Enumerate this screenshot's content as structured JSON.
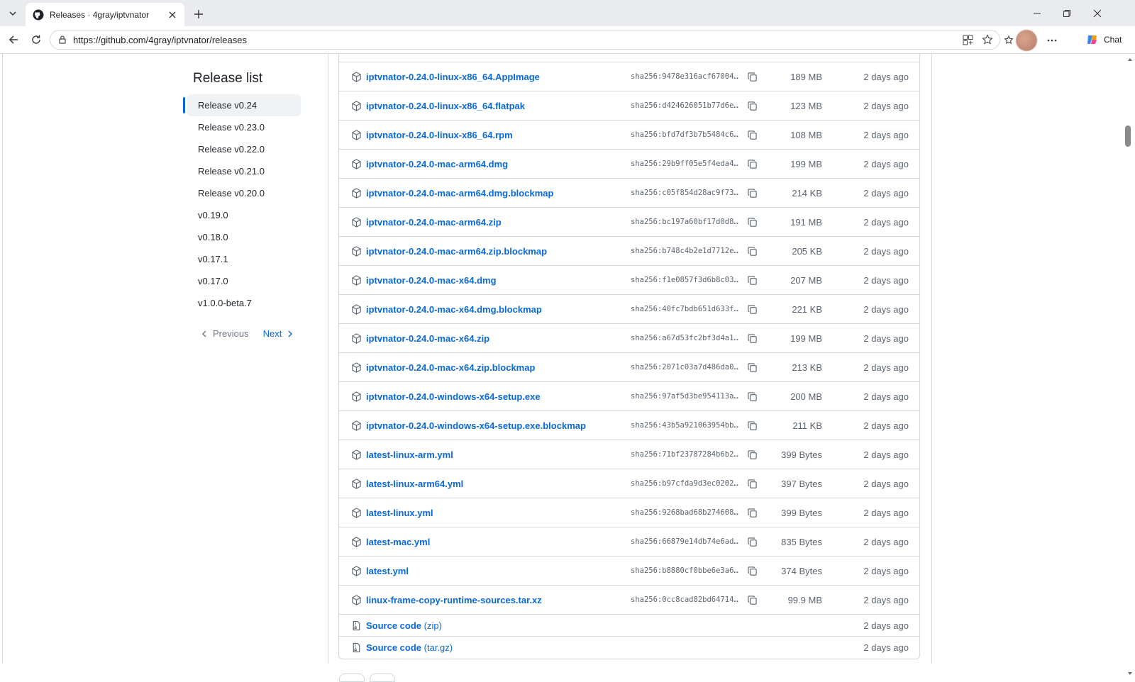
{
  "browser": {
    "tab_title": "Releases · 4gray/iptvnator",
    "url": "https://github.com/4gray/iptvnator/releases",
    "chat_label": "Chat"
  },
  "sidebar": {
    "heading": "Release list",
    "items": [
      {
        "label": "Release v0.24",
        "active": true
      },
      {
        "label": "Release v0.23.0"
      },
      {
        "label": "Release v0.22.0"
      },
      {
        "label": "Release v0.21.0"
      },
      {
        "label": "Release v0.20.0"
      },
      {
        "label": "v0.19.0"
      },
      {
        "label": "v0.18.0"
      },
      {
        "label": "v0.17.1"
      },
      {
        "label": "v0.17.0"
      },
      {
        "label": "v1.0.0-beta.7"
      }
    ],
    "pager": {
      "previous": "Previous",
      "next": "Next"
    }
  },
  "assets": [
    {
      "name": "iptvnator-0.24.0-linux-x86_64.AppImage",
      "sha": "sha256:9478e316acf67004c…",
      "size": "189 MB",
      "date": "2 days ago"
    },
    {
      "name": "iptvnator-0.24.0-linux-x86_64.flatpak",
      "sha": "sha256:d424626051b77d6e0…",
      "size": "123 MB",
      "date": "2 days ago"
    },
    {
      "name": "iptvnator-0.24.0-linux-x86_64.rpm",
      "sha": "sha256:bfd7df3b7b5484c66…",
      "size": "108 MB",
      "date": "2 days ago"
    },
    {
      "name": "iptvnator-0.24.0-mac-arm64.dmg",
      "sha": "sha256:29b9ff05e5f4eda4a…",
      "size": "199 MB",
      "date": "2 days ago"
    },
    {
      "name": "iptvnator-0.24.0-mac-arm64.dmg.blockmap",
      "sha": "sha256:c05f854d28ac9f732…",
      "size": "214 KB",
      "date": "2 days ago"
    },
    {
      "name": "iptvnator-0.24.0-mac-arm64.zip",
      "sha": "sha256:bc197a60bf17d0d85…",
      "size": "191 MB",
      "date": "2 days ago"
    },
    {
      "name": "iptvnator-0.24.0-mac-arm64.zip.blockmap",
      "sha": "sha256:b748c4b2e1d7712e6…",
      "size": "205 KB",
      "date": "2 days ago"
    },
    {
      "name": "iptvnator-0.24.0-mac-x64.dmg",
      "sha": "sha256:f1e0857f3d6b8c03b…",
      "size": "207 MB",
      "date": "2 days ago"
    },
    {
      "name": "iptvnator-0.24.0-mac-x64.dmg.blockmap",
      "sha": "sha256:40fc7bdb651d633f5…",
      "size": "221 KB",
      "date": "2 days ago"
    },
    {
      "name": "iptvnator-0.24.0-mac-x64.zip",
      "sha": "sha256:a67d53fc2bf3d4a1b…",
      "size": "199 MB",
      "date": "2 days ago"
    },
    {
      "name": "iptvnator-0.24.0-mac-x64.zip.blockmap",
      "sha": "sha256:2071c03a7d486da07…",
      "size": "213 KB",
      "date": "2 days ago"
    },
    {
      "name": "iptvnator-0.24.0-windows-x64-setup.exe",
      "sha": "sha256:97af5d3be954113ae…",
      "size": "200 MB",
      "date": "2 days ago"
    },
    {
      "name": "iptvnator-0.24.0-windows-x64-setup.exe.blockmap",
      "sha": "sha256:43b5a921063954bb4…",
      "size": "211 KB",
      "date": "2 days ago"
    },
    {
      "name": "latest-linux-arm.yml",
      "sha": "sha256:71bf23787284b6b2c…",
      "size": "399 Bytes",
      "date": "2 days ago"
    },
    {
      "name": "latest-linux-arm64.yml",
      "sha": "sha256:b97cfda9d3ec02022…",
      "size": "397 Bytes",
      "date": "2 days ago"
    },
    {
      "name": "latest-linux.yml",
      "sha": "sha256:9268bad68b2746088…",
      "size": "399 Bytes",
      "date": "2 days ago"
    },
    {
      "name": "latest-mac.yml",
      "sha": "sha256:66879e14db74e6ad0…",
      "size": "835 Bytes",
      "date": "2 days ago"
    },
    {
      "name": "latest.yml",
      "sha": "sha256:b8880cf0bbe6e3a67…",
      "size": "374 Bytes",
      "date": "2 days ago"
    },
    {
      "name": "linux-frame-copy-runtime-sources.tar.xz",
      "sha": "sha256:0cc8cad82bd64714d…",
      "size": "99.9 MB",
      "date": "2 days ago"
    }
  ],
  "source_code": [
    {
      "name": "Source code",
      "suffix": "(zip)",
      "date": "2 days ago"
    },
    {
      "name": "Source code",
      "suffix": "(tar.gz)",
      "date": "2 days ago"
    }
  ]
}
